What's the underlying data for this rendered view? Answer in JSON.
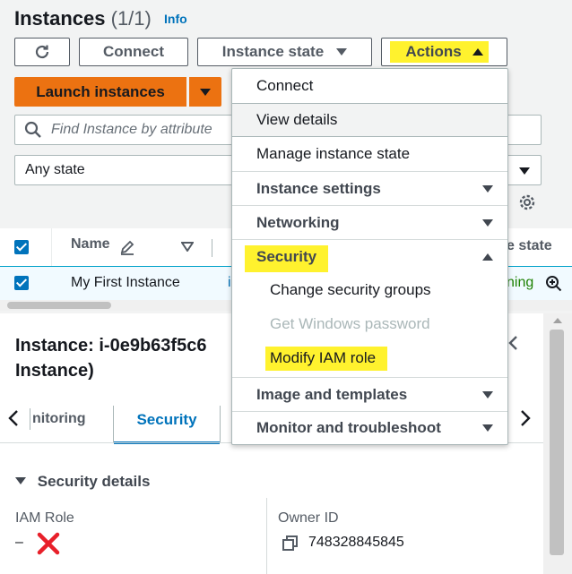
{
  "header": {
    "title": "Instances",
    "count": "(1/1)",
    "info_link": "Info"
  },
  "toolbar": {
    "connect_label": "Connect",
    "instance_state_label": "Instance state",
    "actions_label": "Actions",
    "launch_label": "Launch instances"
  },
  "search": {
    "placeholder": "Find Instance by attribute"
  },
  "filter": {
    "selected": "Any state"
  },
  "table": {
    "columns": [
      "Name",
      "Instance state"
    ],
    "name_header": "Name",
    "state_header_visible": "e state",
    "rows": [
      {
        "name": "My First Instance",
        "id_fragment": "i",
        "state_fragment": "ning"
      }
    ]
  },
  "actions_menu": {
    "items": [
      {
        "label": "Connect"
      },
      {
        "label": "View details"
      },
      {
        "label": "Manage instance state"
      },
      {
        "label": "Instance settings"
      },
      {
        "label": "Networking"
      },
      {
        "label": "Security"
      },
      {
        "label": "Change security groups"
      },
      {
        "label": "Get Windows password"
      },
      {
        "label": "Modify IAM role"
      },
      {
        "label": "Image and templates"
      },
      {
        "label": "Monitor and troubleshoot"
      }
    ]
  },
  "details": {
    "title_line1": "Instance: i-0e9b63f5c6",
    "title_line2": "Instance)",
    "tabs": [
      {
        "label": "nitoring"
      },
      {
        "label": "Security"
      }
    ],
    "section_title": "Security details",
    "iam_role_label": "IAM Role",
    "iam_role_value": "–",
    "owner_id_label": "Owner ID",
    "owner_id_value": "748328845845"
  },
  "colors": {
    "highlight": "#fff22e",
    "primary_orange": "#ec7211",
    "link_blue": "#0073bb",
    "running_green": "#1d8102",
    "error_red": "#e8202a"
  }
}
